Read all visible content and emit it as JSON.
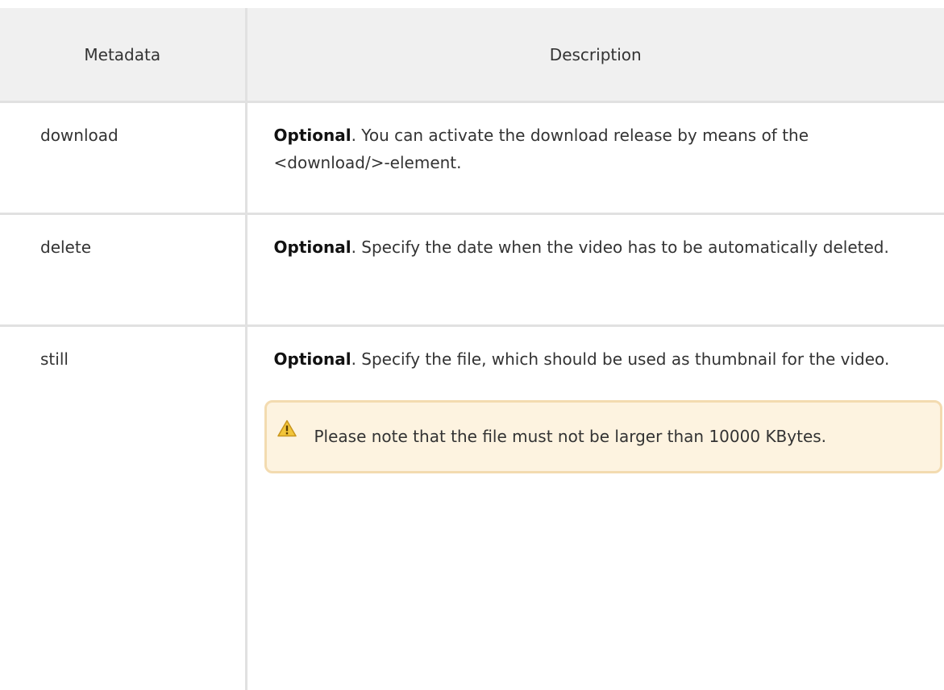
{
  "table": {
    "headers": {
      "metadata": "Metadata",
      "description": "Description"
    },
    "rows": [
      {
        "name": "download",
        "label": "Optional",
        "text": ". You can activate the download release by means of the <download/>-element."
      },
      {
        "name": "delete",
        "label": "Optional",
        "text": ". Specify the date when the video has to be automatically deleted."
      },
      {
        "name": "still",
        "label": "Optional",
        "text": ". Specify the file, which should be used as thumbnail for the video."
      }
    ]
  },
  "note": {
    "icon": "warning-icon",
    "text": "Please note that the file must not be larger than 10000 KBytes.",
    "background_color": "#fdf3e0",
    "border_color": "#f3dbb0"
  }
}
